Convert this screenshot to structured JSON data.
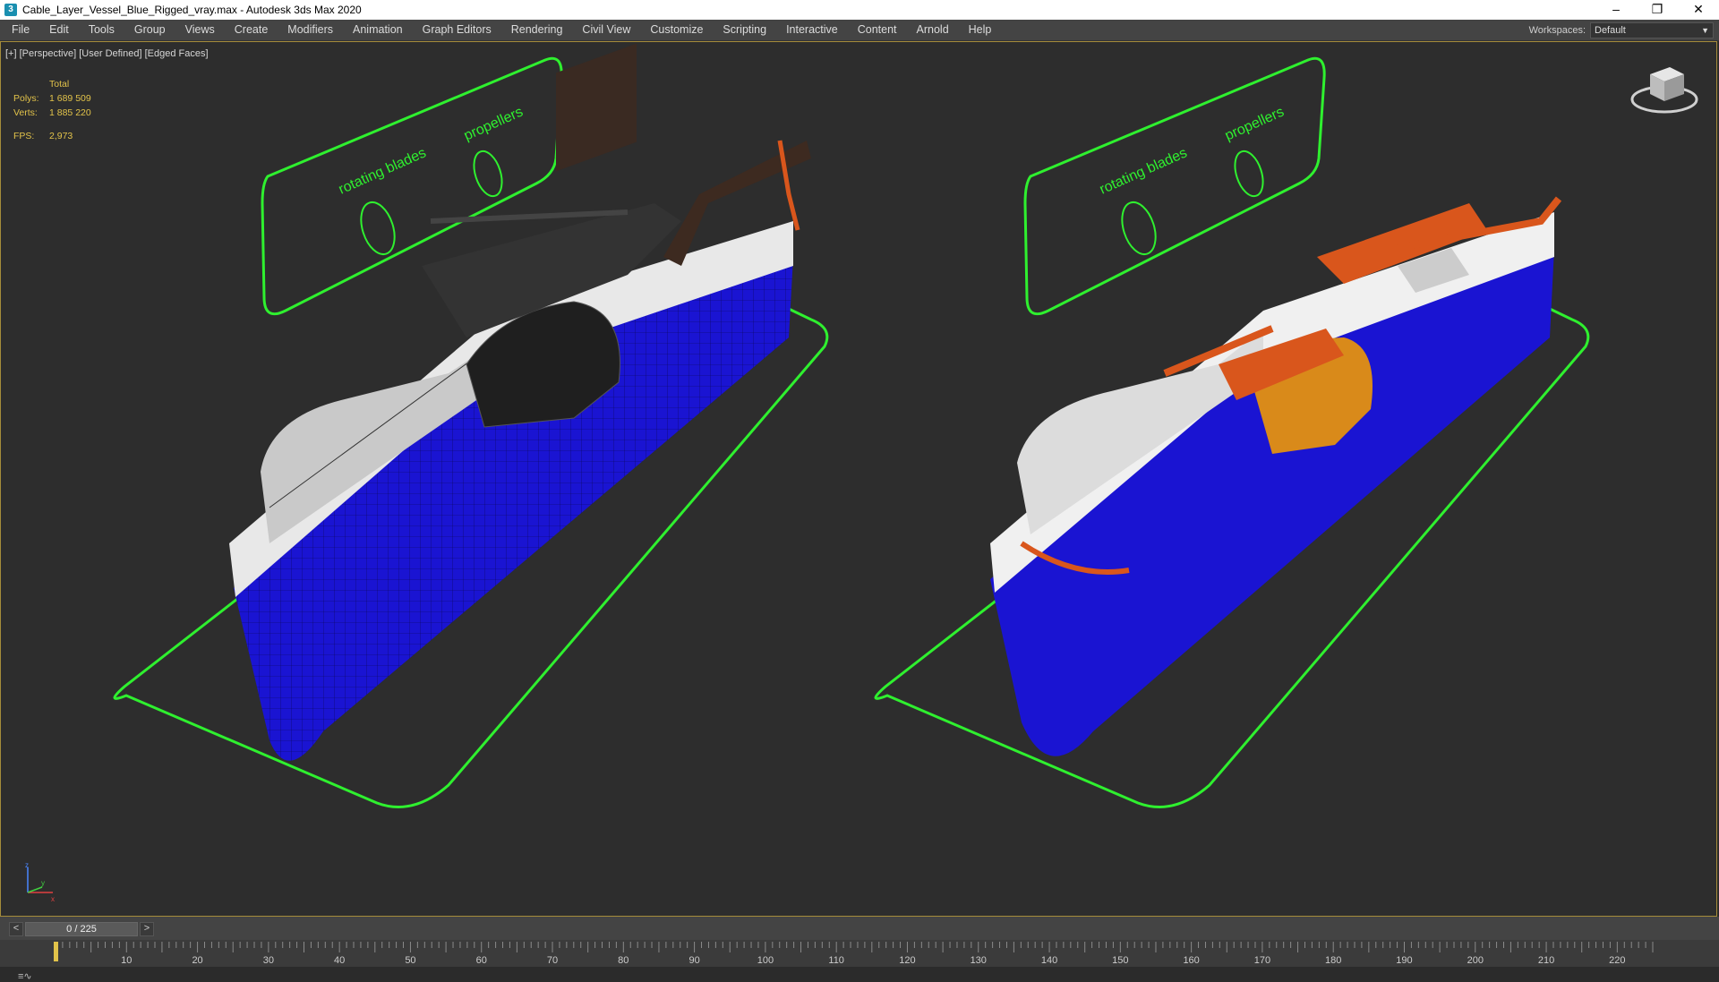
{
  "window": {
    "app_icon_glyph": "3",
    "title": "Cable_Layer_Vessel_Blue_Rigged_vray.max - Autodesk 3ds Max 2020",
    "controls": {
      "minimize": "–",
      "restore": "❐",
      "close": "✕"
    }
  },
  "menu": [
    "File",
    "Edit",
    "Tools",
    "Group",
    "Views",
    "Create",
    "Modifiers",
    "Animation",
    "Graph Editors",
    "Rendering",
    "Civil View",
    "Customize",
    "Scripting",
    "Interactive",
    "Content",
    "Arnold",
    "Help"
  ],
  "workspace": {
    "label": "Workspaces:",
    "value": "Default"
  },
  "viewport": {
    "label": "[+] [Perspective] [User Defined] [Edged Faces]",
    "stats": {
      "header": "Total",
      "polys_label": "Polys:",
      "polys": "1 689 509",
      "verts_label": "Verts:",
      "verts": "1 885 220",
      "fps_label": "FPS:",
      "fps": "2,973"
    },
    "controls_left": {
      "rotating": "rotating blades",
      "propellers": "propellers"
    },
    "controls_right": {
      "rotating": "rotating blades",
      "propellers": "propellers"
    },
    "axis": {
      "x": "x",
      "y": "y",
      "z": "z"
    }
  },
  "timeline": {
    "frame": "0 / 225",
    "prev": "<",
    "next": ">",
    "curve": "≡∿"
  },
  "ruler": {
    "max": 225,
    "labels": [
      "10",
      "20",
      "30",
      "40",
      "50",
      "60",
      "70",
      "80",
      "90",
      "100",
      "110",
      "120",
      "130",
      "140",
      "150",
      "160",
      "170",
      "180",
      "190",
      "200",
      "210",
      "220"
    ]
  },
  "colors": {
    "control_green": "#2ff02f",
    "hull_blue": "#1a14d2",
    "crane_orange": "#d9561c",
    "stats_yellow": "#e2c34a"
  }
}
